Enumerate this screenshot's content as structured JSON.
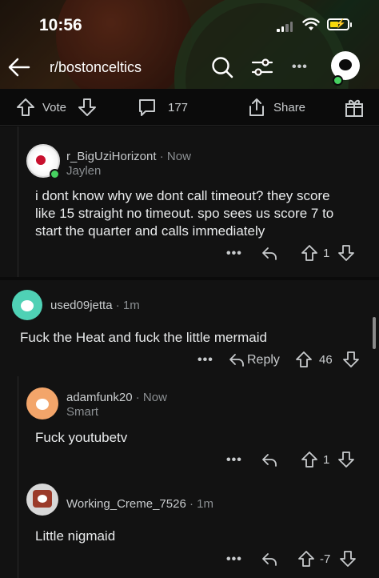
{
  "status": {
    "time": "10:56"
  },
  "nav": {
    "subreddit": "r/bostonceltics"
  },
  "actionbar": {
    "vote_label": "Vote",
    "comments_count": "177",
    "share_label": "Share"
  },
  "comments": [
    {
      "username": "r_BigUziHorizont",
      "time": "Now",
      "flair": "Jaylen",
      "body_lines": [
        "i dont know why we dont call timeout? they score",
        "like 15 straight no timeout. spo sees us score 7 to",
        "start the quarter and calls immediately"
      ],
      "votes": "1"
    },
    {
      "username": "used09jetta",
      "time": "1m",
      "body": "Fuck the Heat and fuck the little mermaid",
      "reply_label": "Reply",
      "votes": "46"
    },
    {
      "username": "adamfunk20",
      "time": "Now",
      "flair": "Smart",
      "body": "Fuck youtubetv",
      "votes": "1"
    },
    {
      "username": "Working_Creme_7526",
      "time": "1m",
      "body": "Little nigmaid",
      "votes": "-7"
    }
  ],
  "symbols": {
    "dot": "·",
    "more": "•••"
  },
  "colors": {
    "background": "#0b0b0b",
    "panel": "#121212",
    "text": "#d7dadc",
    "online": "#46d160",
    "battery": "#f5d90a"
  }
}
